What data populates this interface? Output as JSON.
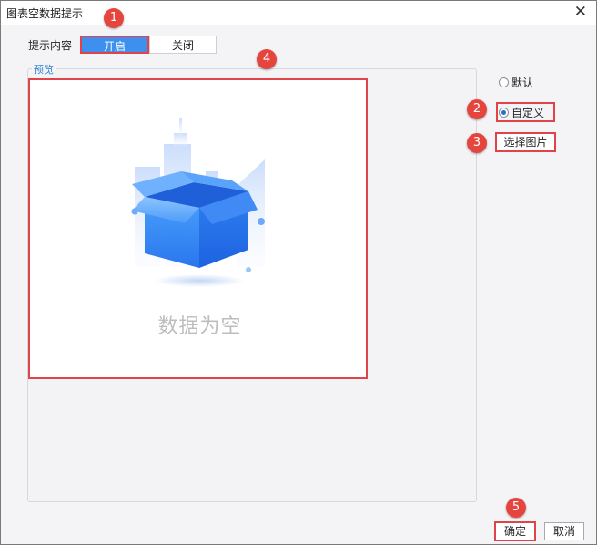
{
  "window": {
    "title": "图表空数据提示",
    "close_icon": "close-x-icon"
  },
  "content_toggle": {
    "label": "提示内容",
    "on_label": "开启",
    "off_label": "关闭",
    "selected": "开启"
  },
  "preview": {
    "group_label": "预览",
    "empty_text": "数据为空",
    "illustration": "empty-data-box-illustration"
  },
  "image_mode": {
    "options": [
      {
        "label": "默认",
        "checked": false
      },
      {
        "label": "自定义",
        "checked": true
      }
    ],
    "pick_button": "选择图片"
  },
  "footer": {
    "ok_label": "确定",
    "cancel_label": "取消"
  },
  "badges": [
    "1",
    "2",
    "3",
    "4",
    "5"
  ],
  "colors": {
    "accent": "#3d90ee",
    "highlight_border": "#e0444a",
    "badge": "#e5453d",
    "preview_label": "#2d7fd3"
  }
}
